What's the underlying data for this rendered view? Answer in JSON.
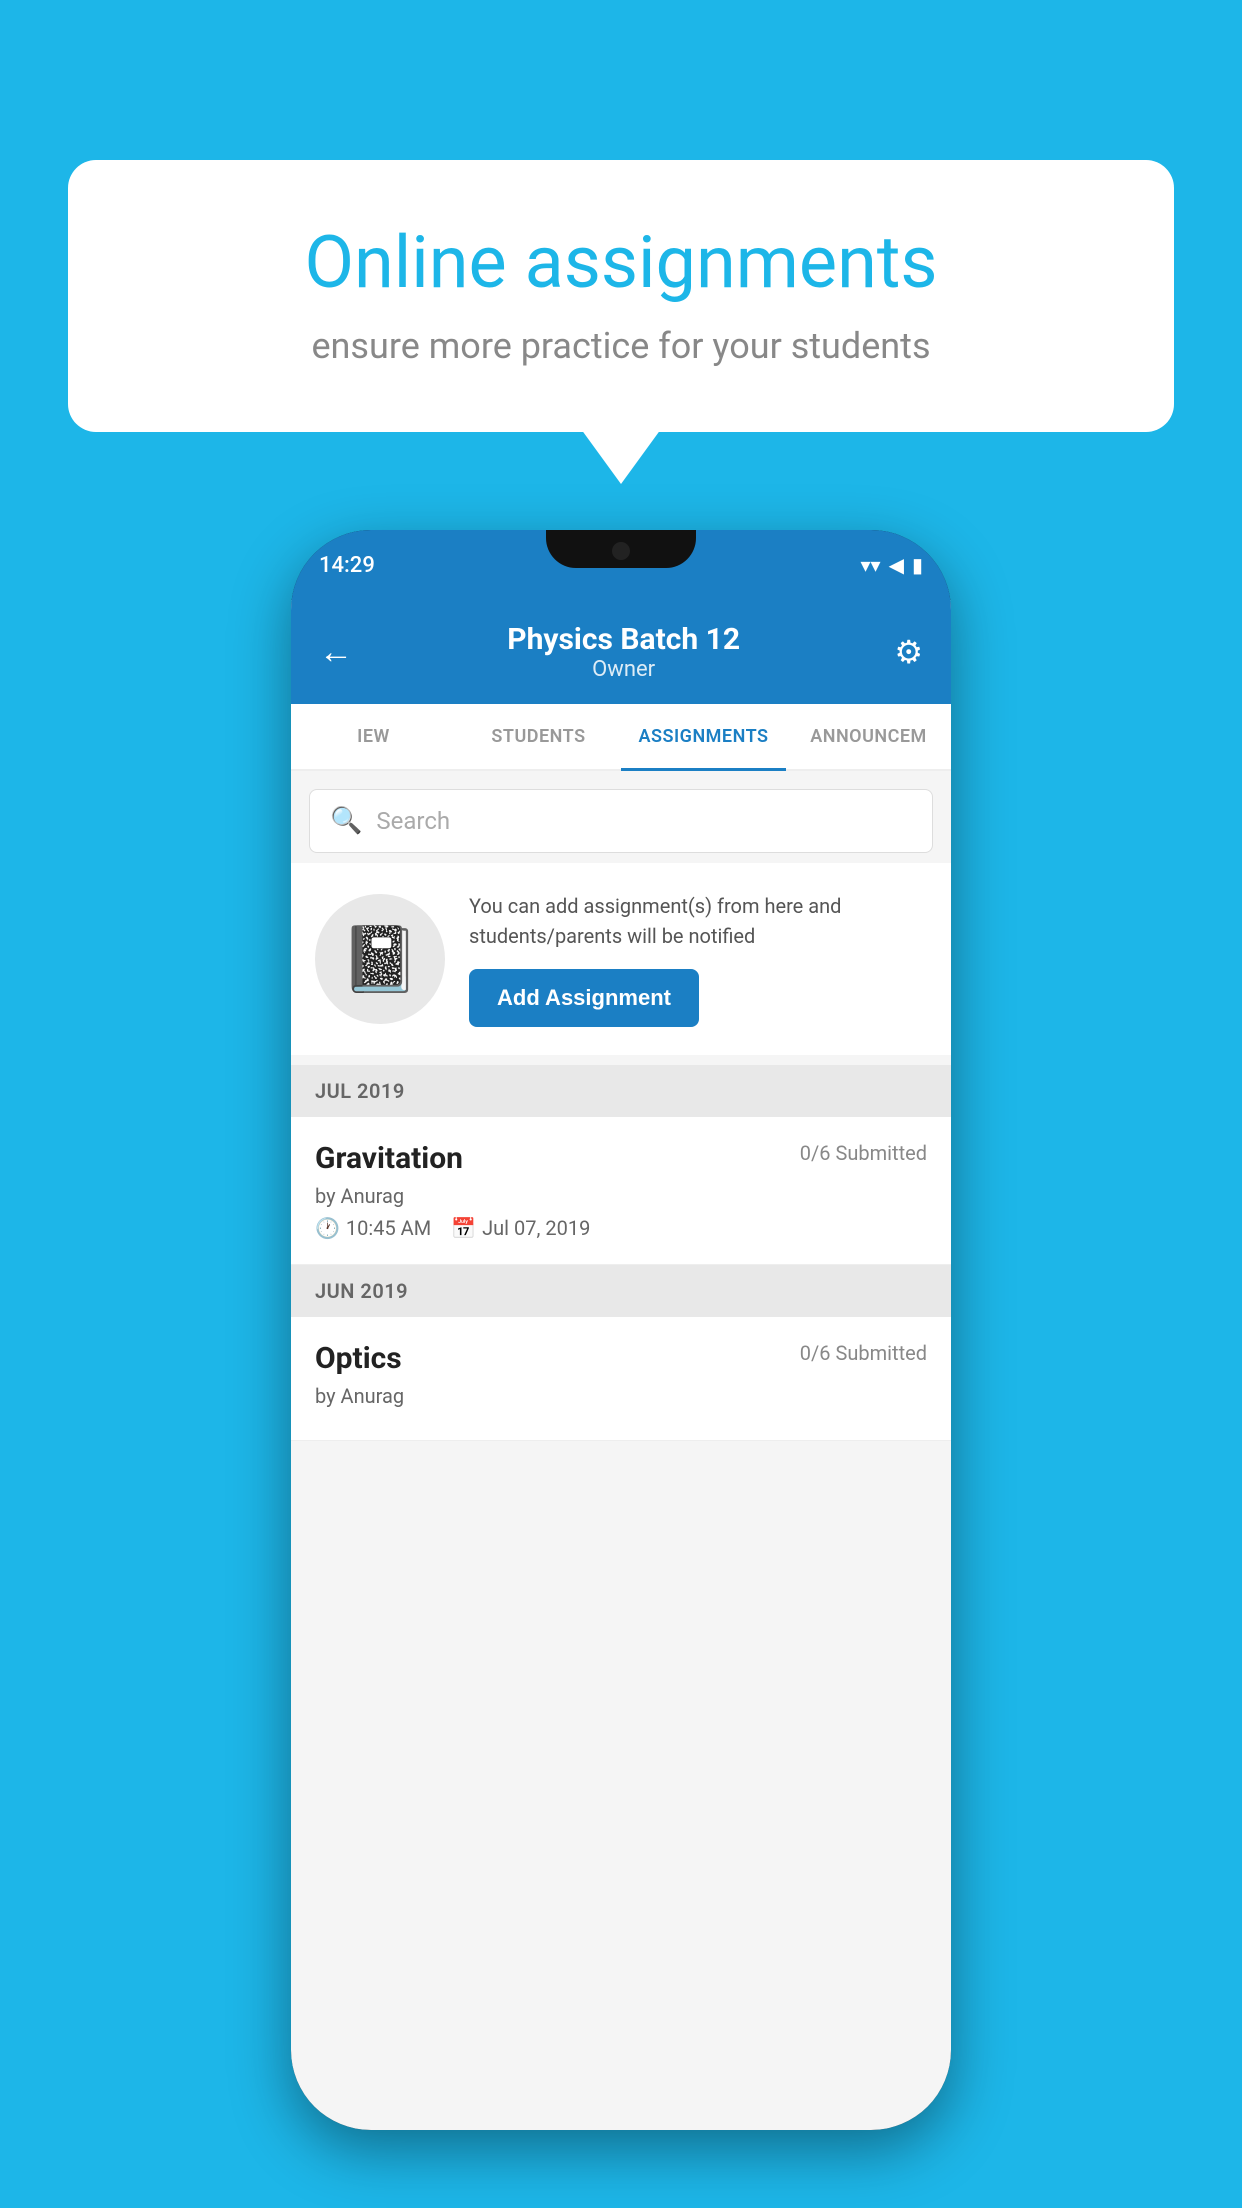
{
  "background_color": "#1db6e8",
  "bubble": {
    "title": "Online assignments",
    "subtitle": "ensure more practice for your students"
  },
  "phone": {
    "status_bar": {
      "time": "14:29",
      "icons": [
        "wifi",
        "signal",
        "battery"
      ]
    },
    "header": {
      "title": "Physics Batch 12",
      "subtitle": "Owner",
      "back_label": "←",
      "settings_label": "⚙"
    },
    "tabs": [
      {
        "label": "IEW",
        "active": false
      },
      {
        "label": "STUDENTS",
        "active": false
      },
      {
        "label": "ASSIGNMENTS",
        "active": true
      },
      {
        "label": "ANNOUNCEM",
        "active": false
      }
    ],
    "search": {
      "placeholder": "Search"
    },
    "promo": {
      "icon": "📓",
      "text": "You can add assignment(s) from here and students/parents will be notified",
      "button_label": "Add Assignment"
    },
    "sections": [
      {
        "month": "JUL 2019",
        "assignments": [
          {
            "name": "Gravitation",
            "submitted": "0/6 Submitted",
            "author": "by Anurag",
            "time": "10:45 AM",
            "date": "Jul 07, 2019"
          }
        ]
      },
      {
        "month": "JUN 2019",
        "assignments": [
          {
            "name": "Optics",
            "submitted": "0/6 Submitted",
            "author": "by Anurag",
            "time": "",
            "date": ""
          }
        ]
      }
    ]
  }
}
